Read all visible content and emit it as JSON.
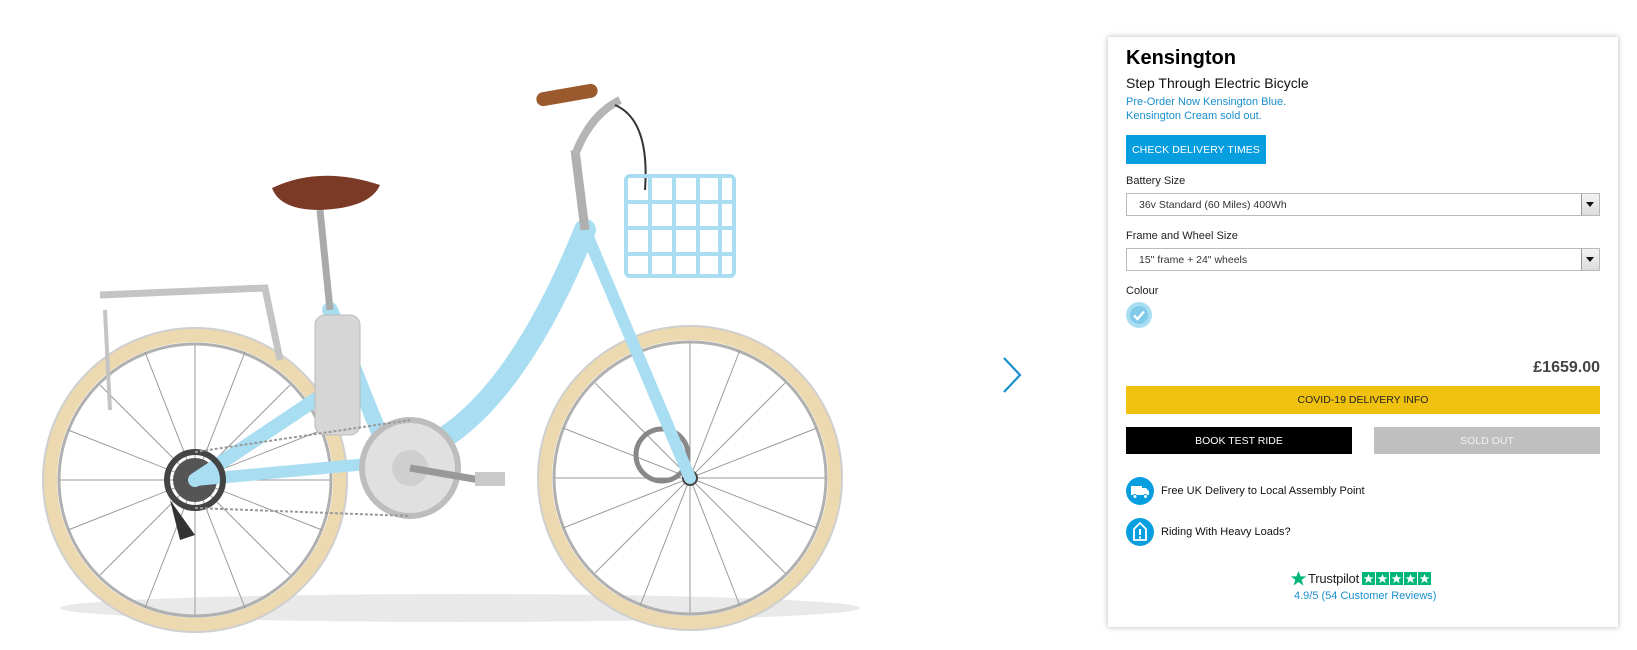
{
  "product": {
    "name": "Kensington",
    "subtitle": "Step Through Electric Bicycle",
    "notice_line1": "Pre-Order Now Kensington Blue.",
    "notice_line2": "Kensington Cream sold out."
  },
  "buttons": {
    "check_delivery": "CHECK DELIVERY TIMES",
    "covid_info": "COVID-19 DELIVERY INFO",
    "book_test_ride": "BOOK TEST RIDE",
    "sold_out": "SOLD OUT"
  },
  "options": {
    "battery": {
      "label": "Battery Size",
      "selected": "36v Standard (60 Miles) 400Wh"
    },
    "frame": {
      "label": "Frame and Wheel Size",
      "selected": "15\" frame + 24\" wheels"
    },
    "colour": {
      "label": "Colour",
      "selected_swatch": "#a9def2"
    }
  },
  "price": "£1659.00",
  "features": [
    {
      "icon": "delivery-van-icon",
      "text": "Free UK Delivery to Local Assembly Point"
    },
    {
      "icon": "info-exclamation-icon",
      "text": "Riding With Heavy Loads?"
    }
  ],
  "trustpilot": {
    "brand": "Trustpilot",
    "rating_text": "4.9/5 (54 Customer Reviews)",
    "stars": 5
  },
  "colors": {
    "accent_blue": "#079ee0",
    "link_blue": "#1a8fcf",
    "covid_yellow": "#f0c20f",
    "sold_out_grey": "#bfbfbf",
    "trustpilot_green": "#00b67a",
    "bike_frame": "#a9def2"
  }
}
